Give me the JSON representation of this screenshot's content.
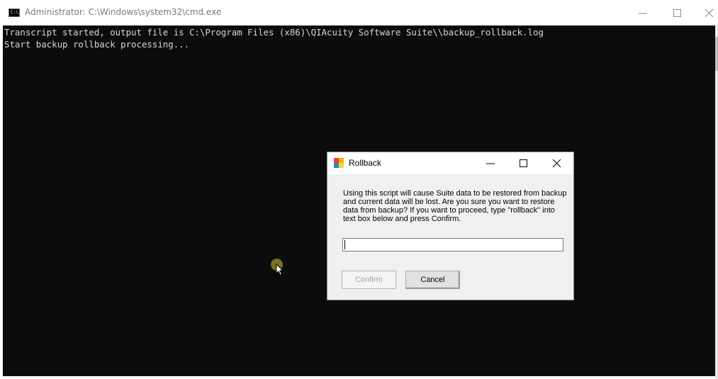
{
  "console_window": {
    "title": "Administrator: C:\\Windows\\system32\\cmd.exe",
    "icon": "cmd-icon",
    "icon_text": "C:\\.",
    "lines": [
      "Transcript started, output file is C:\\Program Files (x86)\\QIAcuity Software Suite\\\\backup_rollback.log",
      "Start backup rollback processing..."
    ]
  },
  "dialog": {
    "title": "Rollback",
    "icon": "app-icon",
    "message": "Using this script will cause Suite data to be restored from backup and current data will be lost. Are you sure you want to restore data from backup? If you want to proceed, type \"rollback\" into text box below and press Confirm.",
    "input": {
      "value": "",
      "placeholder": ""
    },
    "buttons": {
      "confirm": "Confirm",
      "cancel": "Cancel"
    },
    "confirm_enabled": false
  },
  "colors": {
    "console_bg": "#0c0c0c",
    "console_text": "#d8d8d8",
    "dialog_bg": "#f0f0f0",
    "cursor_highlight": "#8a8428"
  }
}
